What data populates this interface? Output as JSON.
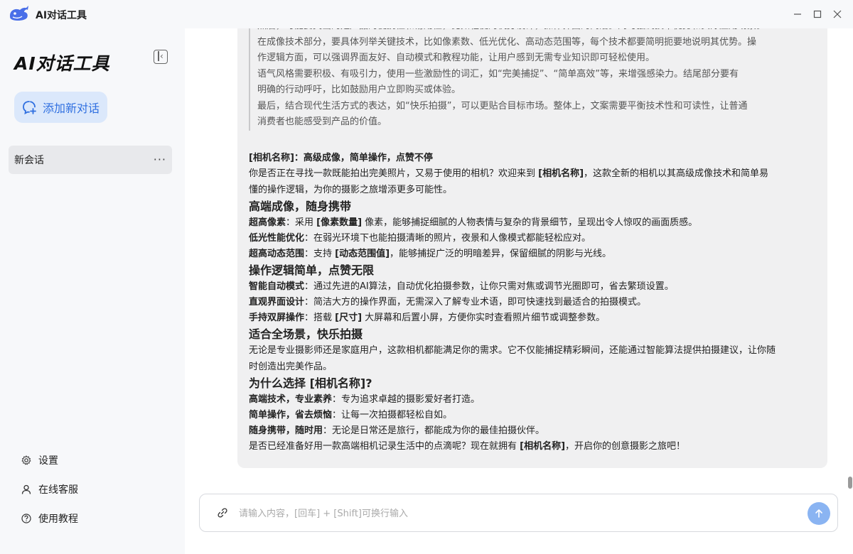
{
  "window": {
    "title": "AI对话工具"
  },
  "sidebar": {
    "title": "AI对话工具",
    "new_chat_label": "添加新对话",
    "sessions": [
      {
        "label": "新会话"
      }
    ],
    "bottom_items": [
      {
        "label": "设置",
        "icon": "gear-icon"
      },
      {
        "label": "在线客服",
        "icon": "user-icon"
      },
      {
        "label": "使用教程",
        "icon": "help-icon"
      }
    ]
  },
  "message": {
    "quote_lines": [
      "然后，可能要突出的是产品的便携性和易用性，比如轻便的机身设计，操作界面的简洁。同时强调技术优势和实际应用场景。",
      "在成像技术部分，要具体列举关键技术，比如像素数、低光优化、高动态范围等，每个技术都要简明扼要地说明其优势。操",
      "作逻辑方面，可以强调界面友好、自动模式和教程功能，让用户感到无需专业知识即可轻松使用。",
      "语气风格需要积极、有吸引力，使用一些激励性的词汇，如“完美捕捉”、“简单高效”等，来增强感染力。结尾部分要有",
      "明确的行动呼吁，比如鼓励用户立即购买或体验。",
      "最后，结合现代生活方式的表达，如“快乐拍摄”，可以更贴合目标市场。整体上，文案需要平衡技术性和可读性，让普通",
      "消费者也能感受到产品的价值。"
    ],
    "title_line": "[相机名称]：高级成像，简单操作，点赞不停",
    "intro_1": "你是否正在寻找一款既能拍出完美照片，又易于使用的相机？欢迎来到 ",
    "intro_bold": "[相机名称]",
    "intro_2": "，这款全新的相机以其高级成像技术和简单易",
    "intro_3": "懂的操作逻辑，为你的摄影之旅增添更多可能性。",
    "sections": [
      {
        "heading": "高端成像，随身携带",
        "items": [
          {
            "bold": "超高像素",
            "text": "：采用 ",
            "bold2": "[像素数量]",
            "text2": " 像素，能够捕捉细腻的人物表情与复杂的背景细节，呈现出令人惊叹的画面质感。"
          },
          {
            "bold": "低光性能优化",
            "text": "：在弱光环境下也能拍摄清晰的照片，夜景和人像模式都能轻松应对。",
            "bold2": "",
            "text2": ""
          },
          {
            "bold": "超高动态范围",
            "text": "：支持 ",
            "bold2": "[动态范围值]",
            "text2": "，能够捕捉广泛的明暗差异，保留细腻的阴影与光线。"
          }
        ]
      },
      {
        "heading": "操作逻辑简单，点赞无限",
        "items": [
          {
            "bold": "智能自动模式",
            "text": "：通过先进的AI算法，自动优化拍摄参数，让你只需对焦或调节光圈即可，省去繁琐设置。",
            "bold2": "",
            "text2": ""
          },
          {
            "bold": "直观界面设计",
            "text": "：简洁大方的操作界面，无需深入了解专业术语，即可快速找到最适合的拍摄模式。",
            "bold2": "",
            "text2": ""
          },
          {
            "bold": "手持双屏操作",
            "text": "：搭载 ",
            "bold2": "[尺寸]",
            "text2": " 大屏幕和后置小屏，方便你实时查看照片细节或调整参数。"
          }
        ]
      },
      {
        "heading": "适合全场景，快乐拍摄",
        "paragraph_1": "无论是专业摄影师还是家庭用户，这款相机都能满足你的需求。它不仅能捕捉精彩瞬间，还能通过智能算法提供拍摄建议，让你随",
        "paragraph_2": "时创造出完美作品。"
      },
      {
        "heading": "为什么选择 [相机名称]?",
        "items": [
          {
            "bold": "高端技术，专业素养",
            "text": "：专为追求卓越的摄影爱好者打造。",
            "bold2": "",
            "text2": ""
          },
          {
            "bold": "简单操作，省去烦恼",
            "text": "：让每一次拍摄都轻松自如。",
            "bold2": "",
            "text2": ""
          },
          {
            "bold": "随身携带，随时用",
            "text": "：无论是日常还是旅行，都能成为你的最佳拍摄伙伴。",
            "bold2": "",
            "text2": ""
          }
        ]
      }
    ],
    "closing_1": "是否已经准备好用一款高端相机记录生活中的点滴呢？现在就拥有 ",
    "closing_bold": "[相机名称]",
    "closing_2": "，开启你的创意摄影之旅吧！"
  },
  "input": {
    "placeholder": "请输入内容，[回车] + [Shift]可换行输入",
    "value": ""
  },
  "colors": {
    "accent": "#2f6fe0",
    "new_chat_bg": "#dbe8fb",
    "send_button": "#8ab4f2",
    "bubble_bg": "#f0f0f1"
  }
}
